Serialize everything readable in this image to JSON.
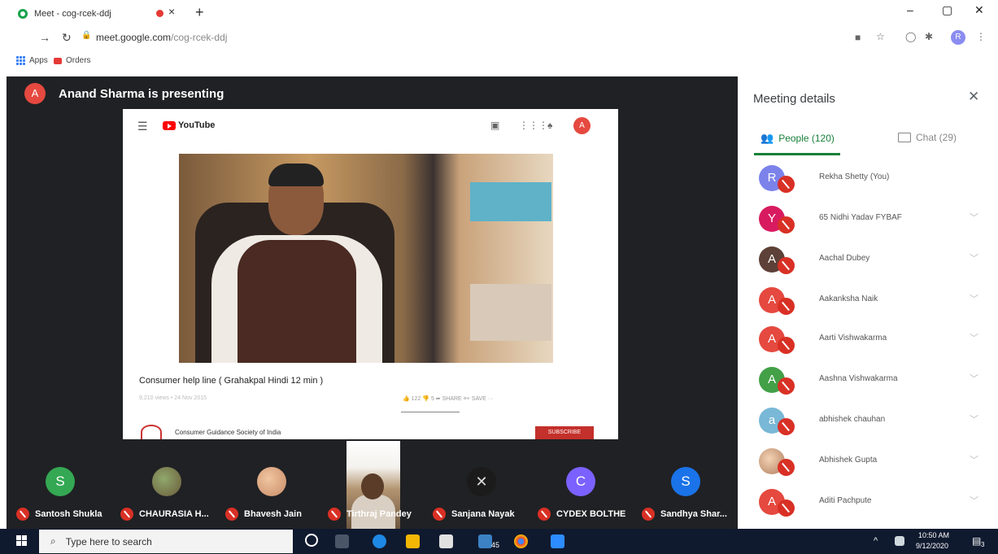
{
  "browser": {
    "tab_title": "Meet - cog-rcek-ddj",
    "tab_close": "×",
    "new_tab": "+",
    "url_host": "meet.google.com",
    "url_path": "/cog-rcek-ddj",
    "profile_initial": "R",
    "bookmarks": [
      "Apps",
      "Orders"
    ],
    "window_controls": [
      "–",
      "▢",
      "✕"
    ]
  },
  "meet": {
    "presenter_initial": "A",
    "presenter_text": "Anand Sharma is presenting",
    "shared_screen": {
      "logo_text": "YouTube",
      "avatar_initial": "A",
      "video_title": "Consumer help line ( Grahakpal Hindi 12 min )",
      "video_meta": "9,210 views • 24 Nov 2015",
      "actions": "👍 122   👎 5   ➦ SHARE   ≡+ SAVE   ···",
      "channel": "Consumer Guidance Society of India",
      "subscribe": "SUBSCRIBE"
    },
    "tiles": [
      {
        "initial": "S",
        "name": "Santosh Shukla",
        "color": "#34a853"
      },
      {
        "initial": "",
        "name": "CHAURASIA H...",
        "color": "#6b5a3a"
      },
      {
        "initial": "",
        "name": "Bhavesh Jain",
        "color": "#c98b68"
      },
      {
        "initial": "",
        "name": "Tirthraj Pandey",
        "color": "#5a3c28"
      },
      {
        "initial": "",
        "name": "Sanjana Nayak",
        "color": "#1b1b1b"
      },
      {
        "initial": "C",
        "name": "CYDEX BOLTHE",
        "color": "#7b61ff"
      },
      {
        "initial": "S",
        "name": "Sandhya Shar...",
        "color": "#1a73e8"
      }
    ]
  },
  "sidebar": {
    "title": "Meeting details",
    "close": "✕",
    "people_tab": "People (120)",
    "chat_tab": "Chat (29)",
    "people": [
      {
        "initial": "R",
        "name": "Rekha Shetty (You)",
        "color": "#7b83eb"
      },
      {
        "initial": "Y",
        "name": "65 Nidhi Yadav FYBAF",
        "color": "#d81b60"
      },
      {
        "initial": "A",
        "name": "Aachal Dubey",
        "color": "#5d4037"
      },
      {
        "initial": "A",
        "name": "Aakanksha Naik",
        "color": "#e5493f"
      },
      {
        "initial": "A",
        "name": "Aarti Vishwakarma",
        "color": "#e5493f"
      },
      {
        "initial": "A",
        "name": "Aashna Vishwakarma",
        "color": "#43a047"
      },
      {
        "initial": "a",
        "name": "abhishek chauhan",
        "color": "#79b8d6"
      },
      {
        "initial": "",
        "name": "Abhishek Gupta",
        "color": "#d8b08a"
      },
      {
        "initial": "A",
        "name": "Aditi Pachpute",
        "color": "#e5493f"
      }
    ]
  },
  "taskbar": {
    "search_placeholder": "Type here to search",
    "time": "10:50 AM",
    "date": "9/12/2020",
    "badge": "45",
    "notif": "3"
  }
}
